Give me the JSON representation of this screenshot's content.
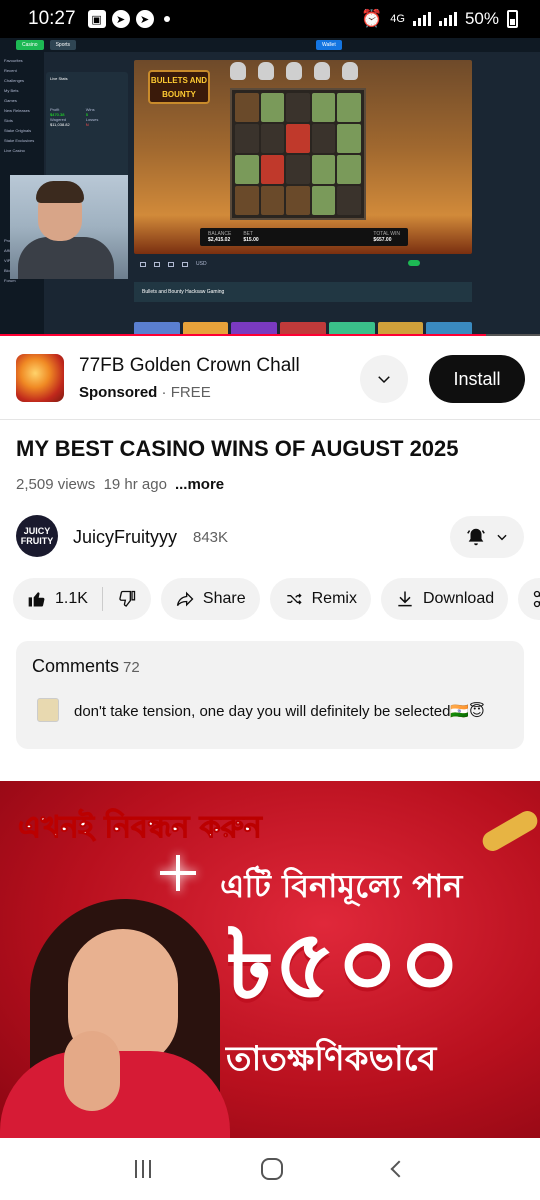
{
  "status_bar": {
    "time": "10:27",
    "network": "4G",
    "battery": "50%"
  },
  "video": {
    "top_tabs": [
      "Casino",
      "Sports"
    ],
    "wallet_label": "Wallet",
    "sidebar_items": [
      "Favourites",
      "Recent",
      "Challenges",
      "My Bets",
      "Games",
      "New Releases",
      "Slots",
      "Stake Originals",
      "Stake Exclusives",
      "Live Casino",
      "Promotions",
      "Affiliate",
      "VIP Club",
      "Blog",
      "Forum"
    ],
    "stats_panel": {
      "title": "Live Stats",
      "profit_label": "Profit",
      "profit": "$470.38",
      "wins_label": "Wins",
      "wins": "5",
      "wagered_label": "Wagered",
      "wagered": "$11,038.82",
      "losses_label": "Losses",
      "losses": "N"
    },
    "game_logo": "BULLETS AND BOUNTY",
    "balance_label": "BALANCE",
    "balance": "$2,415.02",
    "bet_label": "BET",
    "bet": "$15.00",
    "total_win_label": "TOTAL WIN",
    "total_win": "$657.00",
    "currency": "USD",
    "game_info": "Bullets and Bounty   Hacksaw Gaming",
    "progress": 0.9
  },
  "ad": {
    "title": "77FB Golden Crown Chall",
    "sponsored": "Sponsored",
    "price": "FREE",
    "install_label": "Install"
  },
  "video_info": {
    "title": "MY BEST CASINO WINS OF AUGUST 2025",
    "views": "2,509 views",
    "age": "19 hr ago",
    "more": "...more"
  },
  "channel": {
    "avatar_text": "JUICY FRUITY",
    "name": "JuicyFruityyy",
    "subscribers": "843K"
  },
  "actions": {
    "likes": "1.1K",
    "share": "Share",
    "remix": "Remix",
    "download": "Download"
  },
  "comments": {
    "title": "Comments",
    "count": "72",
    "top_comment": "don't take tension, one day you will definitely be selected🇮🇳😇"
  },
  "banner": {
    "line1": "এখনই নিবন্ধন করুন",
    "line2": "এটি বিনামূল্যে পান",
    "amount": "৳৫০০",
    "line4": "তাতক্ষণিকভাবে"
  }
}
